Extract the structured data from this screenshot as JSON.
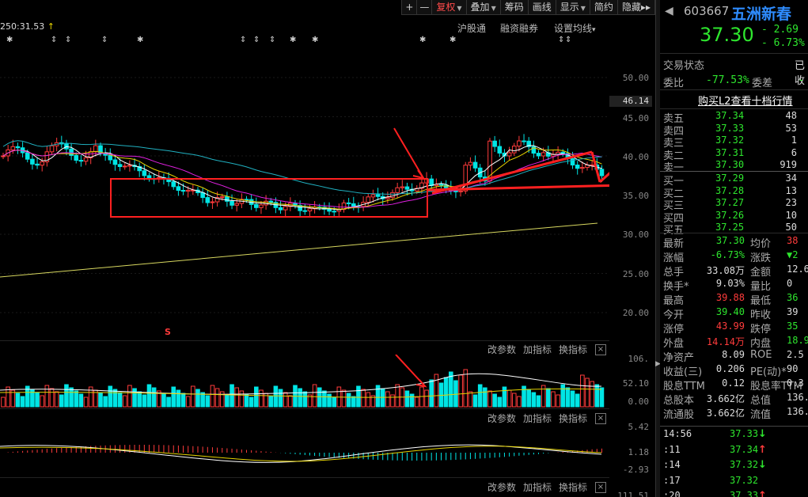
{
  "toolbar": {
    "plus": "+",
    "minus": "—",
    "fuquan": "复权",
    "diejia": "叠加",
    "chouma": "筹码",
    "huaxian": "画线",
    "xianshi": "显示",
    "jianyue": "简约",
    "yincang": "隐藏",
    "double_arrow": "▸▸"
  },
  "info_line": "250:31.53",
  "menu": {
    "hugutong": "沪股通",
    "rongzi": "融资融券",
    "setma": "设置均线"
  },
  "price_axis": [
    "50.00",
    "45.00",
    "40.00",
    "35.00",
    "30.00",
    "25.00",
    "20.00"
  ],
  "current_price_marker": "46.14",
  "s_marker": "S",
  "vol_panel": {
    "params": "改参数",
    "add": "加指标",
    "swap": "换指标",
    "close": "×",
    "axis": [
      "106.",
      "52.10",
      "0.00"
    ]
  },
  "macd_panel": {
    "params": "改参数",
    "add": "加指标",
    "swap": "换指标",
    "close": "×",
    "axis": [
      "5.42",
      "1.18",
      "-2.93"
    ]
  },
  "bottom_panel": {
    "params": "改参数",
    "add": "加指标",
    "swap": "换指标",
    "close": "×",
    "axis_partial": "111.51"
  },
  "stock": {
    "code": "603667",
    "name": "五洲新春",
    "price": "37.30",
    "change": "- 2.69",
    "pct": "- 6.73%"
  },
  "trade_status": {
    "label": "交易状态",
    "value": "已收"
  },
  "weibi": {
    "label": "委比",
    "value": "-77.53%",
    "label2": "委差",
    "value2": "-"
  },
  "l2_link": "购买L2查看十档行情",
  "asks": [
    {
      "label": "卖五",
      "price": "37.34",
      "vol": "48"
    },
    {
      "label": "卖四",
      "price": "37.33",
      "vol": "53"
    },
    {
      "label": "卖三",
      "price": "37.32",
      "vol": "1"
    },
    {
      "label": "卖二",
      "price": "37.31",
      "vol": "6"
    },
    {
      "label": "卖一",
      "price": "37.30",
      "vol": "919"
    }
  ],
  "bids": [
    {
      "label": "买一",
      "price": "37.29",
      "vol": "34"
    },
    {
      "label": "买二",
      "price": "37.28",
      "vol": "13"
    },
    {
      "label": "买三",
      "price": "37.27",
      "vol": "23"
    },
    {
      "label": "买四",
      "price": "37.26",
      "vol": "10"
    },
    {
      "label": "买五",
      "price": "37.25",
      "vol": "50"
    }
  ],
  "stats": [
    {
      "l1": "最新",
      "v1": "37.30",
      "c1": "green",
      "l2": "均价",
      "v2": "38",
      "c2": "red"
    },
    {
      "l1": "涨幅",
      "v1": "-6.73%",
      "c1": "green",
      "l2": "涨跌",
      "v2": "▼2",
      "c2": "green"
    },
    {
      "l1": "总手",
      "v1": "33.08万",
      "c1": "white",
      "l2": "金额",
      "v2": "12.6",
      "c2": "white"
    },
    {
      "l1": "换手*",
      "v1": "9.03%",
      "c1": "white",
      "l2": "量比",
      "v2": "0",
      "c2": "white"
    },
    {
      "l1": "最高",
      "v1": "39.88",
      "c1": "red",
      "l2": "最低",
      "v2": "36",
      "c2": "green"
    },
    {
      "l1": "今开",
      "v1": "39.40",
      "c1": "green",
      "l2": "昨收",
      "v2": "39",
      "c2": "white"
    },
    {
      "l1": "涨停",
      "v1": "43.99",
      "c1": "red",
      "l2": "跌停",
      "v2": "35",
      "c2": "green"
    },
    {
      "l1": "外盘",
      "v1": "14.14万",
      "c1": "red",
      "l2": "内盘",
      "v2": "18.9",
      "c2": "green"
    },
    {
      "l1": "净资产",
      "v1": "8.09",
      "c1": "white",
      "l2": "ROE",
      "v2": "2.5",
      "c2": "white"
    },
    {
      "l1": "收益(三)",
      "v1": "0.206",
      "c1": "white",
      "l2": "PE(动)*",
      "v2": "90",
      "c2": "white"
    },
    {
      "l1": "股息TTM",
      "v1": "0.12",
      "c1": "white",
      "l2": "股息率TTM",
      "v2": "0.3",
      "c2": "white"
    },
    {
      "l1": "总股本",
      "v1": "3.662亿",
      "c1": "white",
      "l2": "总值",
      "v2": "136.",
      "c2": "white"
    },
    {
      "l1": "流通股",
      "v1": "3.662亿",
      "c1": "white",
      "l2": "流值",
      "v2": "136.",
      "c2": "white"
    }
  ],
  "ticks": [
    {
      "time": "14:56",
      "price": "37.33",
      "arrow": "↓",
      "dir": "green"
    },
    {
      "time": ":11",
      "price": "37.34",
      "arrow": "↑",
      "dir": "red"
    },
    {
      "time": ":14",
      "price": "37.32",
      "arrow": "↓",
      "dir": "green"
    },
    {
      "time": ":17",
      "price": "37.32",
      "arrow": "",
      "dir": "green"
    },
    {
      "time": ":20",
      "price": "37.33",
      "arrow": "↑",
      "dir": "red"
    }
  ],
  "colors": {
    "up": "#ff3b3b",
    "down": "#00e5e5",
    "ma5": "#ffffff",
    "ma10": "#e6d300",
    "ma20": "#e020e0",
    "ma60": "#20b0c0",
    "ma250": "#d8d860",
    "annot": "#ff2020"
  }
}
